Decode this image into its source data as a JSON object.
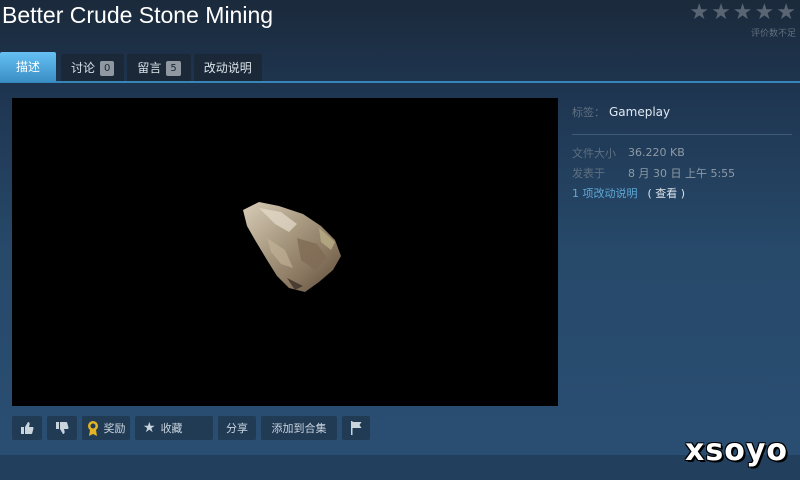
{
  "page": {
    "title": "Better Crude Stone Mining"
  },
  "rating": {
    "stars": 5,
    "text": "评价数不足"
  },
  "tabs": [
    {
      "label": "描述"
    },
    {
      "label": "讨论",
      "count": "0"
    },
    {
      "label": "留言",
      "count": "5"
    },
    {
      "label": "改动说明"
    }
  ],
  "sidebar": {
    "tags_label": "标签：",
    "tags_value": "Gameplay",
    "size_label": "文件大小",
    "size_value": "36.220 KB",
    "posted_label": "发表于",
    "posted_value": "8 月 30 日 上午 5:55",
    "changes_link": "1 项改动说明",
    "view_link": "( 查看 )"
  },
  "actions": {
    "award": "奖励",
    "favorite": "收藏",
    "share": "分享",
    "add_collection": "添加到合集"
  },
  "watermark": "xsoyo",
  "colors": {
    "accent": "#66c0f4",
    "background": "#2a4f73",
    "button": "#213b55"
  }
}
